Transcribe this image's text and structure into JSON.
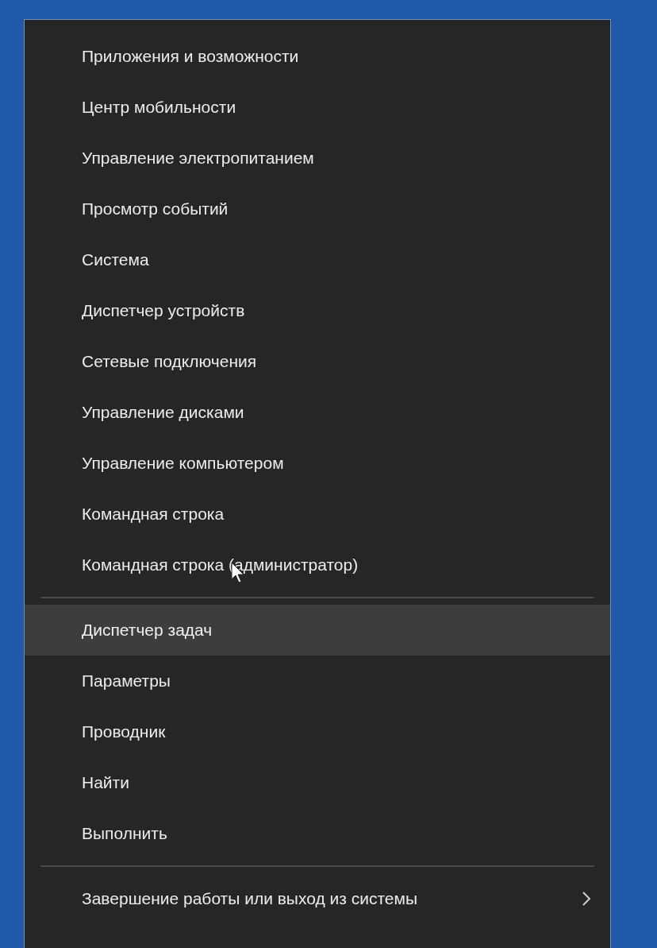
{
  "menu": {
    "groups": [
      {
        "items": [
          {
            "label": "Приложения и возможности",
            "selected": false
          },
          {
            "label": "Центр мобильности",
            "selected": false
          },
          {
            "label": "Управление электропитанием",
            "selected": false
          },
          {
            "label": "Просмотр событий",
            "selected": false
          },
          {
            "label": "Система",
            "selected": false
          },
          {
            "label": "Диспетчер устройств",
            "selected": false
          },
          {
            "label": "Сетевые подключения",
            "selected": false
          },
          {
            "label": "Управление дисками",
            "selected": false
          },
          {
            "label": "Управление компьютером",
            "selected": false
          },
          {
            "label": "Командная строка",
            "selected": false
          },
          {
            "label": "Командная строка (администратор)",
            "selected": false,
            "pointer": true
          }
        ]
      },
      {
        "items": [
          {
            "label": "Диспетчер задач",
            "selected": true
          },
          {
            "label": "Параметры",
            "selected": false
          },
          {
            "label": "Проводник",
            "selected": false
          },
          {
            "label": "Найти",
            "selected": false
          },
          {
            "label": "Выполнить",
            "selected": false
          }
        ]
      },
      {
        "items": [
          {
            "label": "Завершение работы или выход из системы",
            "selected": false,
            "submenu": true
          }
        ]
      }
    ]
  }
}
